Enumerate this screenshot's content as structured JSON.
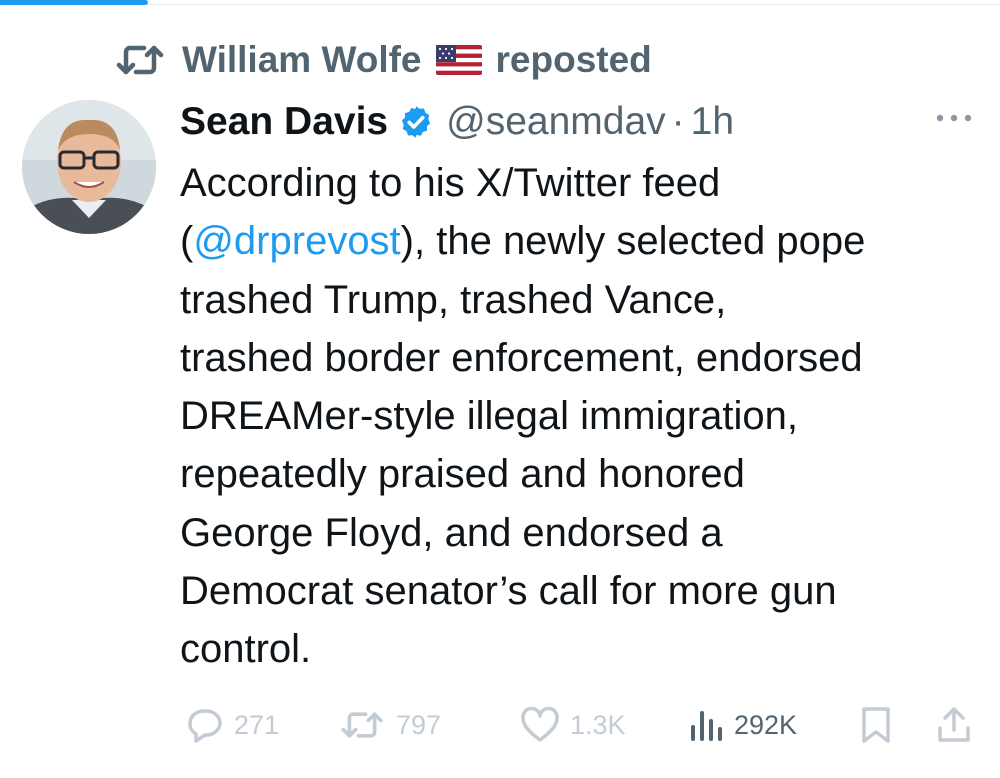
{
  "repost": {
    "user_name": "William Wolfe",
    "flag_emoji": "🇺🇸",
    "action_text": "reposted"
  },
  "author": {
    "display_name": "Sean Davis",
    "handle": "@seanmdav",
    "separator": "·",
    "time": "1h"
  },
  "tweet": {
    "lines": [
      {
        "text": "According to his X/Twitter feed"
      },
      {
        "open": "(",
        "mention": "@drprevost",
        "rest": "), the newly selected pope"
      },
      {
        "text": "trashed Trump, trashed Vance,"
      },
      {
        "text": "trashed border enforcement, endorsed"
      },
      {
        "text": "DREAMer-style illegal immigration,"
      },
      {
        "text": "repeatedly praised and honored"
      },
      {
        "text": "George Floyd, and endorsed a"
      },
      {
        "text": "Democrat senator’s call for more gun"
      },
      {
        "text": "control."
      }
    ]
  },
  "actions": {
    "replies": "271",
    "reposts": "797",
    "likes": "1.3K",
    "views": "292K"
  },
  "icons": {
    "repost": "repost-icon",
    "flag": "us-flag-icon",
    "verified": "verified-badge-icon",
    "more": "more-icon",
    "reply": "reply-icon",
    "retweet": "retweet-icon",
    "like": "heart-icon",
    "views": "views-icon",
    "bookmark": "bookmark-icon",
    "share": "share-icon"
  },
  "colors": {
    "accent": "#1d9bf0",
    "text_primary": "#0f1419",
    "text_secondary": "#536471",
    "faded_action": "#c3ccd4"
  }
}
